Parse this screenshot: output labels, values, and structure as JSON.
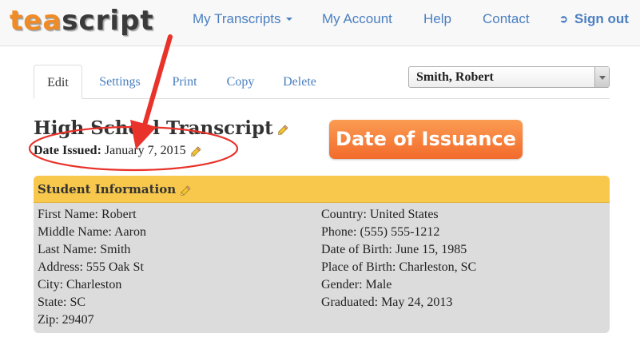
{
  "logo": {
    "part1": "tea",
    "part2": "script"
  },
  "nav": {
    "transcripts": "My Transcripts",
    "account": "My Account",
    "help": "Help",
    "contact": "Contact",
    "signout": "Sign out"
  },
  "tabs": [
    "Edit",
    "Settings",
    "Print",
    "Copy",
    "Delete"
  ],
  "student_select": {
    "value": "Smith, Robert"
  },
  "page_title": "High School Transcript",
  "date_issued": {
    "label": "Date Issued:",
    "value": "January 7, 2015"
  },
  "badge": "Date of Issuance",
  "student_info": {
    "heading": "Student Information",
    "left": [
      "First Name: Robert",
      "Middle Name: Aaron",
      "Last Name: Smith",
      "Address: 555 Oak St",
      "City: Charleston",
      "State: SC",
      "Zip: 29407"
    ],
    "right": [
      "Country: United States",
      "Phone: (555) 555-1212",
      "Date of Birth: June 15, 1985",
      "Place of Birth: Charleston, SC",
      "Gender: Male",
      "Graduated: May 24, 2013"
    ]
  },
  "colors": {
    "brand_orange": "#f08b25",
    "link_blue": "#4a7fc1",
    "panel_header": "#f8c84c",
    "annotation_red": "#e8322a",
    "badge_orange": "#f4763a"
  },
  "icons": [
    "caret-down-icon",
    "sign-out-icon",
    "pencil-icon",
    "select-arrow-icon"
  ]
}
